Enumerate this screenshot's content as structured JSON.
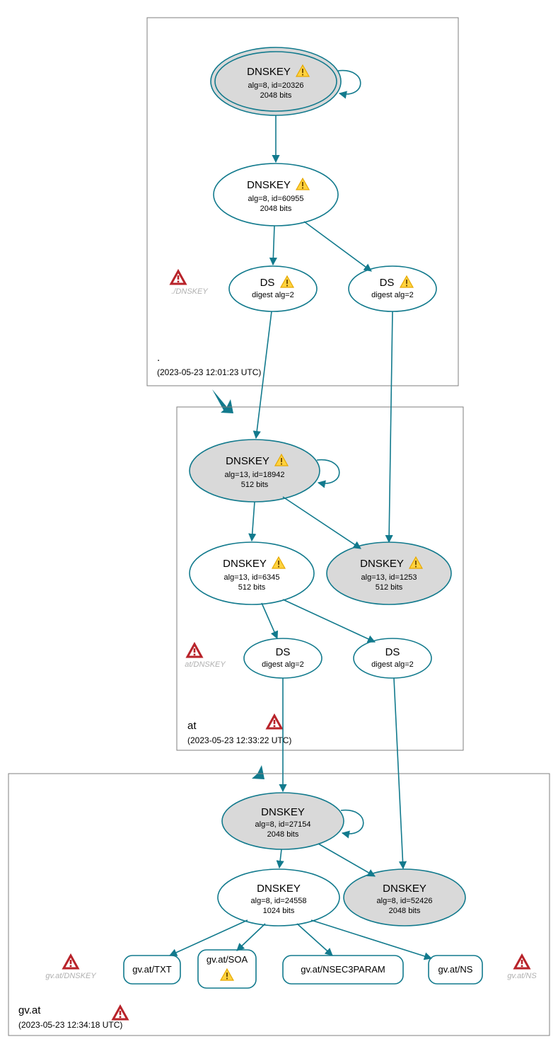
{
  "chart_data": {
    "type": "diagram",
    "description": "DNSSEC validation chain: . -> at -> gv.at",
    "zones": [
      {
        "name": ".",
        "timestamp": "(2023-05-23 12:01:23 UTC)",
        "nodes": [
          {
            "id": "root-ksk",
            "label": "DNSKEY",
            "warn": "yellow",
            "sub1": "alg=8, id=20326",
            "sub2": "2048 bits",
            "fill": "gray",
            "double": true
          },
          {
            "id": "root-zsk",
            "label": "DNSKEY",
            "warn": "yellow",
            "sub1": "alg=8, id=60955",
            "sub2": "2048 bits",
            "fill": "white"
          },
          {
            "id": "root-ds1",
            "label": "DS",
            "warn": "yellow",
            "sub1": "digest alg=2",
            "fill": "white"
          },
          {
            "id": "root-ds2",
            "label": "DS",
            "warn": "yellow",
            "sub1": "digest alg=2",
            "fill": "white"
          }
        ],
        "anchors": [
          {
            "label": "./DNSKEY",
            "warn": "red"
          }
        ]
      },
      {
        "name": "at",
        "timestamp": "(2023-05-23 12:33:22 UTC)",
        "nodes": [
          {
            "id": "at-ksk",
            "label": "DNSKEY",
            "warn": "yellow",
            "sub1": "alg=13, id=18942",
            "sub2": "512 bits",
            "fill": "gray"
          },
          {
            "id": "at-zsk",
            "label": "DNSKEY",
            "warn": "yellow",
            "sub1": "alg=13, id=6345",
            "sub2": "512 bits",
            "fill": "white"
          },
          {
            "id": "at-key2",
            "label": "DNSKEY",
            "warn": "yellow",
            "sub1": "alg=13, id=1253",
            "sub2": "512 bits",
            "fill": "gray"
          },
          {
            "id": "at-ds1",
            "label": "DS",
            "sub1": "digest alg=2",
            "fill": "white"
          },
          {
            "id": "at-ds2",
            "label": "DS",
            "sub1": "digest alg=2",
            "fill": "white"
          }
        ],
        "anchors": [
          {
            "label": "at/DNSKEY",
            "warn": "red"
          }
        ]
      },
      {
        "name": "gv.at",
        "timestamp": "(2023-05-23 12:34:18 UTC)",
        "nodes": [
          {
            "id": "gv-ksk",
            "label": "DNSKEY",
            "sub1": "alg=8, id=27154",
            "sub2": "2048 bits",
            "fill": "gray"
          },
          {
            "id": "gv-zsk",
            "label": "DNSKEY",
            "sub1": "alg=8, id=24558",
            "sub2": "1024 bits",
            "fill": "white"
          },
          {
            "id": "gv-key2",
            "label": "DNSKEY",
            "sub1": "alg=8, id=52426",
            "sub2": "2048 bits",
            "fill": "gray"
          }
        ],
        "records": [
          {
            "label": "gv.at/TXT"
          },
          {
            "label": "gv.at/SOA",
            "warn": "yellow"
          },
          {
            "label": "gv.at/NSEC3PARAM"
          },
          {
            "label": "gv.at/NS"
          }
        ],
        "anchors": [
          {
            "label": "gv.at/DNSKEY",
            "warn": "red"
          },
          {
            "label": "gv.at/NS",
            "warn": "red"
          }
        ],
        "extra_warnings": [
          "red"
        ]
      }
    ],
    "edges": [
      [
        "root-ksk",
        "root-ksk"
      ],
      [
        "root-ksk",
        "root-zsk"
      ],
      [
        "root-zsk",
        "root-ds1"
      ],
      [
        "root-zsk",
        "root-ds2"
      ],
      [
        "root-ds1",
        "at-ksk"
      ],
      [
        "root-ds2",
        "at-key2"
      ],
      [
        "at-ksk",
        "at-ksk"
      ],
      [
        "at-ksk",
        "at-zsk"
      ],
      [
        "at-ksk",
        "at-key2"
      ],
      [
        "at-zsk",
        "at-ds1"
      ],
      [
        "at-zsk",
        "at-ds2"
      ],
      [
        "at-ds1",
        "gv-ksk"
      ],
      [
        "at-ds2",
        "gv-key2"
      ],
      [
        "gv-ksk",
        "gv-ksk"
      ],
      [
        "gv-ksk",
        "gv-zsk"
      ],
      [
        "gv-ksk",
        "gv-key2"
      ],
      [
        "gv-zsk",
        "gv.at/TXT"
      ],
      [
        "gv-zsk",
        "gv.at/SOA"
      ],
      [
        "gv-zsk",
        "gv.at/NSEC3PARAM"
      ],
      [
        "gv-zsk",
        "gv.at/NS"
      ]
    ]
  }
}
